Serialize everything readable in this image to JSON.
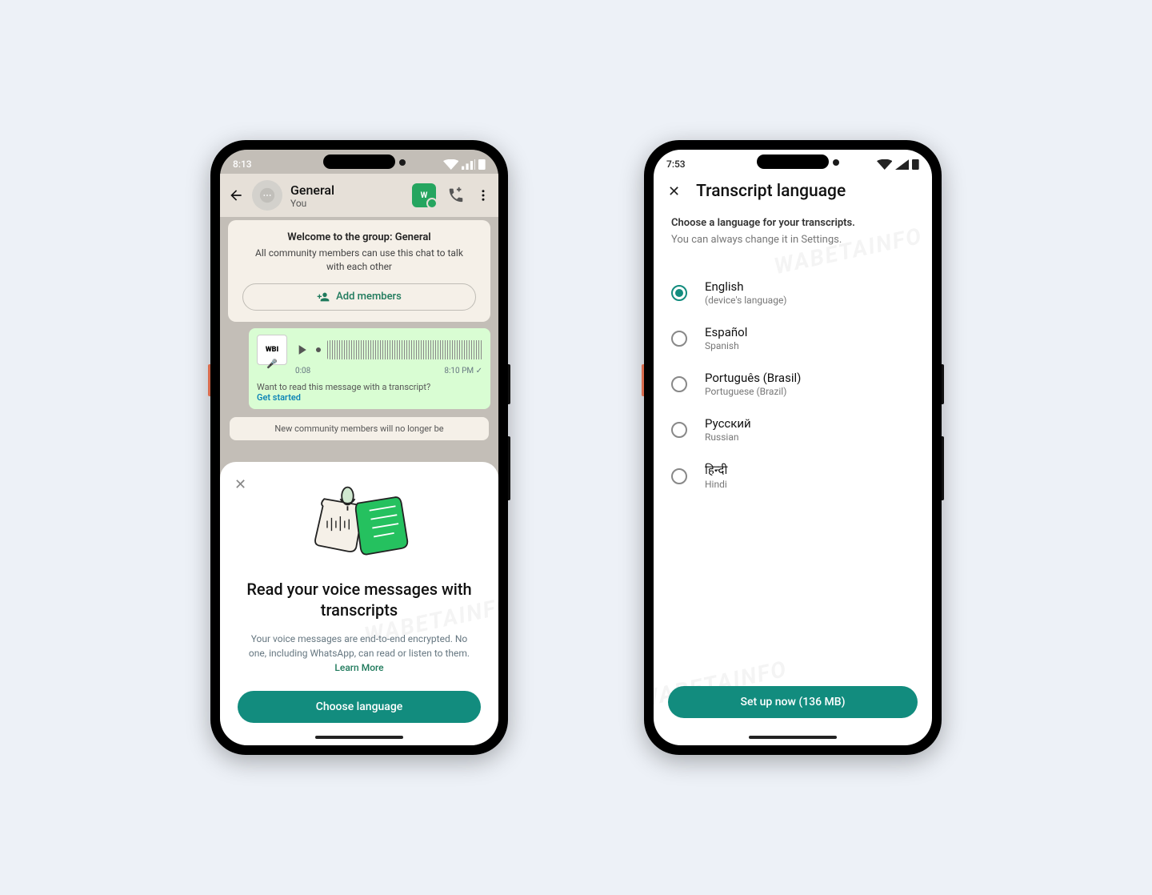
{
  "phone1": {
    "status_time": "8:13",
    "header": {
      "title": "General",
      "subtitle": "You"
    },
    "infocard": {
      "title": "Welcome to the group: General",
      "subtitle": "All community members can use this chat to talk with each other",
      "add_members_label": "Add members"
    },
    "voice_msg": {
      "avatar_text": "WBI",
      "duration": "0:08",
      "timestamp": "8:10 PM",
      "prompt": "Want to read this message with a transcript?",
      "get_started": "Get started"
    },
    "syscard": "New community members will no longer be",
    "sheet": {
      "title": "Read your voice messages with transcripts",
      "body": "Your voice messages are end-to-end encrypted. No one, including WhatsApp, can read or listen to them.",
      "learn_more": "Learn More",
      "button": "Choose language"
    }
  },
  "phone2": {
    "status_time": "7:53",
    "title": "Transcript language",
    "instruction1": "Choose a language for your transcripts.",
    "instruction2": "You can always change it in Settings.",
    "languages": [
      {
        "native": "English",
        "eng": "(device's language)",
        "selected": true
      },
      {
        "native": "Español",
        "eng": "Spanish",
        "selected": false
      },
      {
        "native": "Português (Brasil)",
        "eng": "Portuguese (Brazil)",
        "selected": false
      },
      {
        "native": "Русский",
        "eng": "Russian",
        "selected": false
      },
      {
        "native": "हिन्दी",
        "eng": "Hindi",
        "selected": false
      }
    ],
    "button": "Set up now (136 MB)"
  }
}
